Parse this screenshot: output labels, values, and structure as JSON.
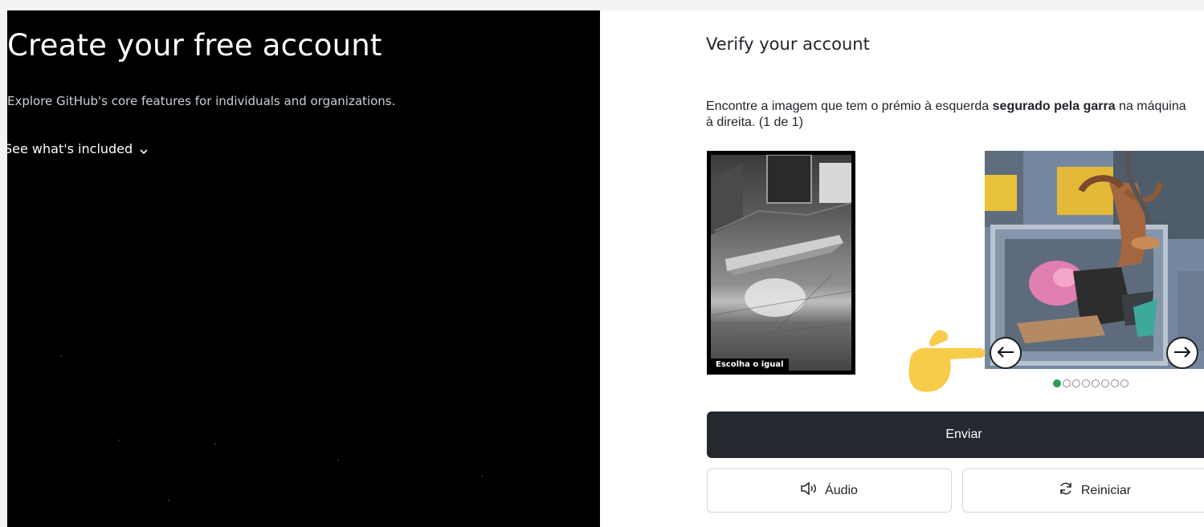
{
  "left_panel": {
    "title": "Create your free account",
    "subtitle": "Explore GitHub's core features for individuals and organizations.",
    "see_included": "See what's included"
  },
  "captcha": {
    "heading": "Verify your account",
    "instruction_part1": "Encontre a imagem que tem o prémio à esquerda ",
    "instruction_bold": "segurado pela garra",
    "instruction_part2": " na máquina à direita. (1 de 1)",
    "reference_caption": "Escolha o igual",
    "pagination": {
      "total": 8,
      "current": 1
    },
    "submit_label": "Enviar",
    "audio_label": "Áudio",
    "restart_label": "Reiniciar"
  },
  "colors": {
    "dark_bg": "#000000",
    "submit_bg": "#24292f",
    "active_dot": "#2d9c52",
    "hand": "#f7cc4a"
  },
  "icons": {
    "see_included": "chevron-down-icon",
    "prev": "arrow-left-icon",
    "next": "arrow-right-icon",
    "audio": "speaker-icon",
    "restart": "refresh-icon",
    "pointer": "pointing-hand-icon"
  }
}
